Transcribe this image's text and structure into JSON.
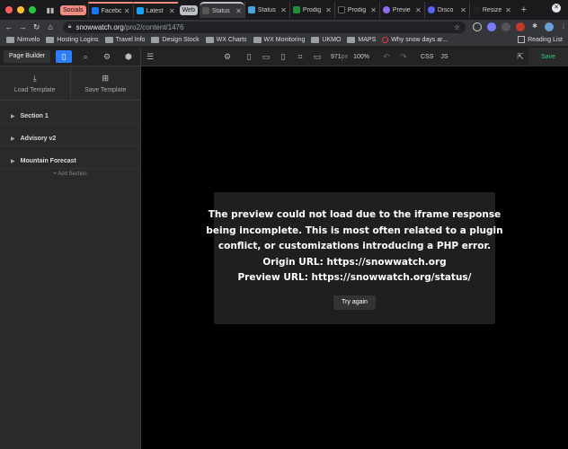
{
  "browser": {
    "tab_groups": [
      {
        "label": "Socials",
        "color": "#f28b82"
      },
      {
        "label": "Web",
        "color": "#bdc1c6"
      }
    ],
    "tabs": [
      {
        "label": "Facebo",
        "fav_color": "#1877f2",
        "group": "Socials"
      },
      {
        "label": "Latest",
        "fav_color": "#1da1f2",
        "group": "Socials"
      },
      {
        "label": "Status",
        "fav_color": "#555555",
        "group": "Web",
        "active": true
      },
      {
        "label": "Status",
        "fav_color": "#4aa3df"
      },
      {
        "label": "Prodig",
        "fav_color": "#1e8e3e"
      },
      {
        "label": "Prodig",
        "fav_color": "#111111"
      },
      {
        "label": "Previe",
        "fav_color": "#8e6cf0"
      },
      {
        "label": "Disco",
        "fav_color": "#5865f2"
      },
      {
        "label": "Resize",
        "fav_color": "#222222"
      }
    ],
    "url_host": "snowwatch.org",
    "url_path": "/pro2/content/1476",
    "bookmarks": [
      "Nimvelo",
      "Hosting Logins",
      "Travel Info",
      "Design Stock",
      "WX Charts",
      "WX Monitoring",
      "UKMO",
      "MAPS"
    ],
    "bookmark_last": "Why snow days ar...",
    "reading_list": "Reading List"
  },
  "builder": {
    "title": "Page Builder",
    "load_template": "Load Template",
    "save_template": "Save Template",
    "sections": [
      "Section 1",
      "Advisory v2",
      "Mountain Forecast"
    ],
    "add_section": "+ Add Section",
    "width": "971",
    "width_unit": "px",
    "zoom": "100%",
    "css": "CSS",
    "js": "JS",
    "save": "Save"
  },
  "preview": {
    "lines": [
      "The preview could not load due to the iframe response",
      "being incomplete. This is most often related to a plugin",
      "conflict, or customizations introducing a PHP error.",
      "Origin URL: https://snowwatch.org",
      "Preview URL: https://snowwatch.org/status/"
    ],
    "try_again": "Try again"
  }
}
